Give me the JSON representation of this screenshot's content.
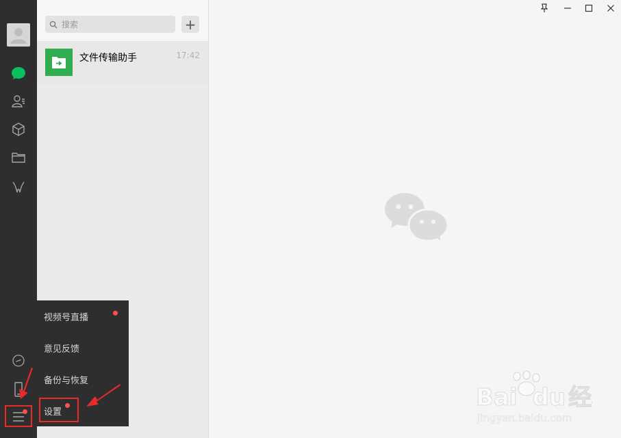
{
  "search": {
    "placeholder": "搜索",
    "add_label": "+"
  },
  "chats": [
    {
      "name": "文件传输助手",
      "time": "17:42",
      "icon": "file-transfer-icon"
    }
  ],
  "sidebar": {
    "icons": [
      "chat-icon",
      "contacts-icon",
      "favorites-cube-icon",
      "files-folder-icon",
      "moments-icon",
      "mini-program-icon",
      "phone-icon",
      "menu-icon"
    ]
  },
  "menu": {
    "items": [
      {
        "label": "视频号直播",
        "badge": true
      },
      {
        "label": "意见反馈",
        "badge": false
      },
      {
        "label": "备份与恢复",
        "badge": false
      },
      {
        "label": "设置",
        "badge": true
      }
    ]
  },
  "watermark": {
    "brand": "Bai",
    "brand2": "du",
    "suffix": "经验",
    "url": "jingyan.baidu.com"
  },
  "colors": {
    "sidebar": "#2e2e2e",
    "accent_green": "#07c160",
    "badge_red": "#fa5151",
    "highlight_red": "#e82a2a"
  }
}
